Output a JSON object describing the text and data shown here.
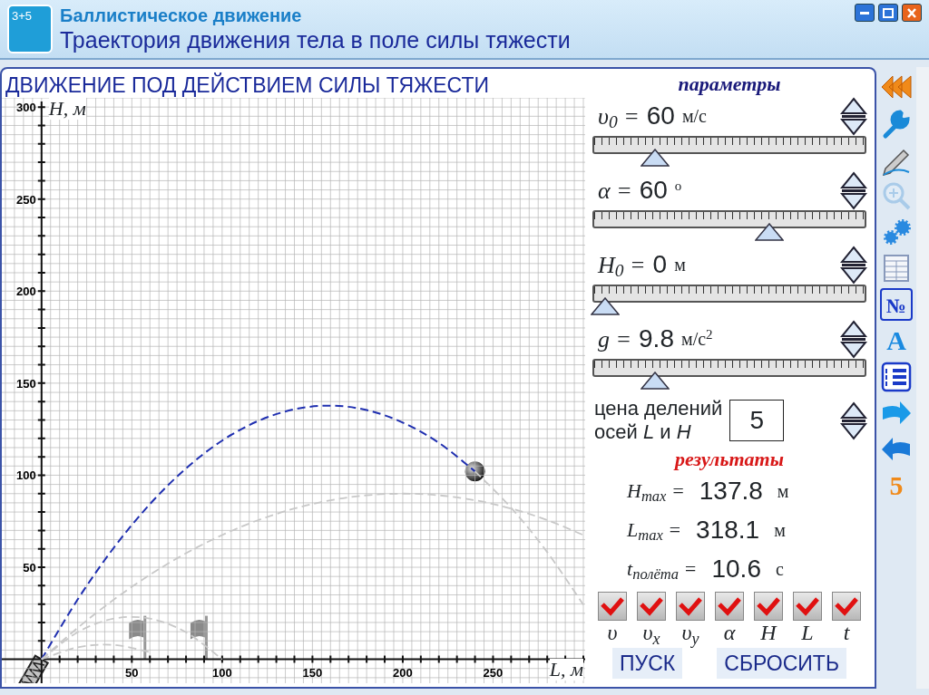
{
  "window": {
    "icon_text": "3+5",
    "title": "Баллистическое движение",
    "subtitle": "Траектория движения тела в поле силы тяжести"
  },
  "panel": {
    "heading": "ДВИЖЕНИЕ ПОД ДЕЙСТВИЕМ СИЛЫ ТЯЖЕСТИ",
    "chart": {
      "chart_data": {
        "type": "line",
        "xlabel": "L, м",
        "ylabel": "H, м",
        "x": [
          0,
          20,
          40,
          60,
          80,
          100,
          120,
          140,
          160,
          180,
          200,
          220,
          240,
          260,
          280,
          300
        ],
        "series": [
          {
            "color": "#1f2fb0",
            "line_style": "dashed",
            "values": [
              0,
              32.5,
              60.6,
              84.3,
              103.7,
              118.8,
              129.5,
              135.8,
              137.8,
              135.4,
              128.6,
              117.6,
              102.1,
              null,
              null,
              null
            ]
          },
          {
            "color": "#c8c8c8",
            "line_style": "dashed",
            "values": [
              null,
              null,
              null,
              null,
              null,
              null,
              null,
              null,
              null,
              null,
              null,
              null,
              102.1,
              82.3,
              58.2,
              29.6
            ]
          },
          {
            "color": "#c8c8c8",
            "line_style": "dashed",
            "values": [
              0,
              17.1,
              32.4,
              45.9,
              57.6,
              67.5,
              75.6,
              81.9,
              86.4,
              89.1,
              90,
              89.1,
              86.4,
              81.9,
              75.6,
              67.5
            ]
          },
          {
            "color": "#c8c8c8",
            "line_style": "dashed",
            "values": [
              0,
              14.7,
              22.1,
              22.1,
              14.7,
              0,
              null,
              null,
              null,
              null,
              null,
              null,
              null,
              null,
              null,
              null
            ]
          },
          {
            "color": "#c8c8c8",
            "line_style": "dashed",
            "values": [
              0,
              6.5,
              7.8,
              3.9,
              null,
              null,
              null,
              null,
              null,
              null,
              null,
              null,
              null,
              null,
              null,
              null
            ]
          }
        ],
        "grid": true,
        "xlim": [
          -22,
          301
        ],
        "ylim": [
          -13,
          305
        ],
        "xticks": [
          50,
          100,
          150,
          200,
          250
        ],
        "yticks": [
          50,
          100,
          150,
          200,
          250,
          300
        ]
      }
    }
  },
  "parameters": {
    "heading": "параметры",
    "items": [
      {
        "label": "υ$_{0}$ =",
        "value": "60",
        "unit": "м/с",
        "level": 0.2
      },
      {
        "label": "α =",
        "value": "60",
        "unit": "$^{o}$",
        "level": 0.66
      },
      {
        "label": "H$_{0}$ =",
        "value": "0",
        "unit": "м",
        "level": 0.0
      },
      {
        "label": "g =",
        "value": "9.8",
        "unit": "м/с$^{2}$",
        "level": 0.2
      }
    ]
  },
  "divisions": {
    "line_1": "цена делений",
    "line_2": "осей *L* и *H*",
    "value": "5"
  },
  "results": {
    "heading": "результаты",
    "items": [
      {
        "label": "H$_{max}$ =",
        "value": "137.8",
        "unit": "м"
      },
      {
        "label": "L$_{max}$ =",
        "value": "318.1",
        "unit": "м"
      },
      {
        "label": "t$_{полёта}$ =",
        "value": "10.6",
        "unit": "с"
      }
    ]
  },
  "toggles": [
    {
      "label": "υ",
      "checked": true
    },
    {
      "label": "υ$_{x}$",
      "checked": true
    },
    {
      "label": "υ$_{y}$",
      "checked": true
    },
    {
      "label": "α",
      "checked": true
    },
    {
      "label": "H",
      "checked": true
    },
    {
      "label": "L",
      "checked": true
    },
    {
      "label": "t",
      "checked": true
    }
  ],
  "buttons": [
    "ПУСК",
    "СБРОСИТЬ"
  ],
  "toolbar": [
    {
      "kind": "rewind",
      "disabled": false
    },
    {
      "kind": "wrench",
      "disabled": false
    },
    {
      "kind": "pencil",
      "disabled": false
    },
    {
      "kind": "zoom",
      "disabled": true
    },
    {
      "kind": "gears",
      "disabled": false
    },
    {
      "kind": "table",
      "disabled": false
    },
    {
      "kind": "glyph",
      "text": "№",
      "disabled": false
    },
    {
      "kind": "glyph",
      "text": "A",
      "disabled": false
    },
    {
      "kind": "list",
      "disabled": false
    },
    {
      "kind": "arrow-right",
      "disabled": false
    },
    {
      "kind": "arrow-left",
      "disabled": false
    },
    {
      "kind": "glyph",
      "text": "5",
      "disabled": false
    }
  ]
}
